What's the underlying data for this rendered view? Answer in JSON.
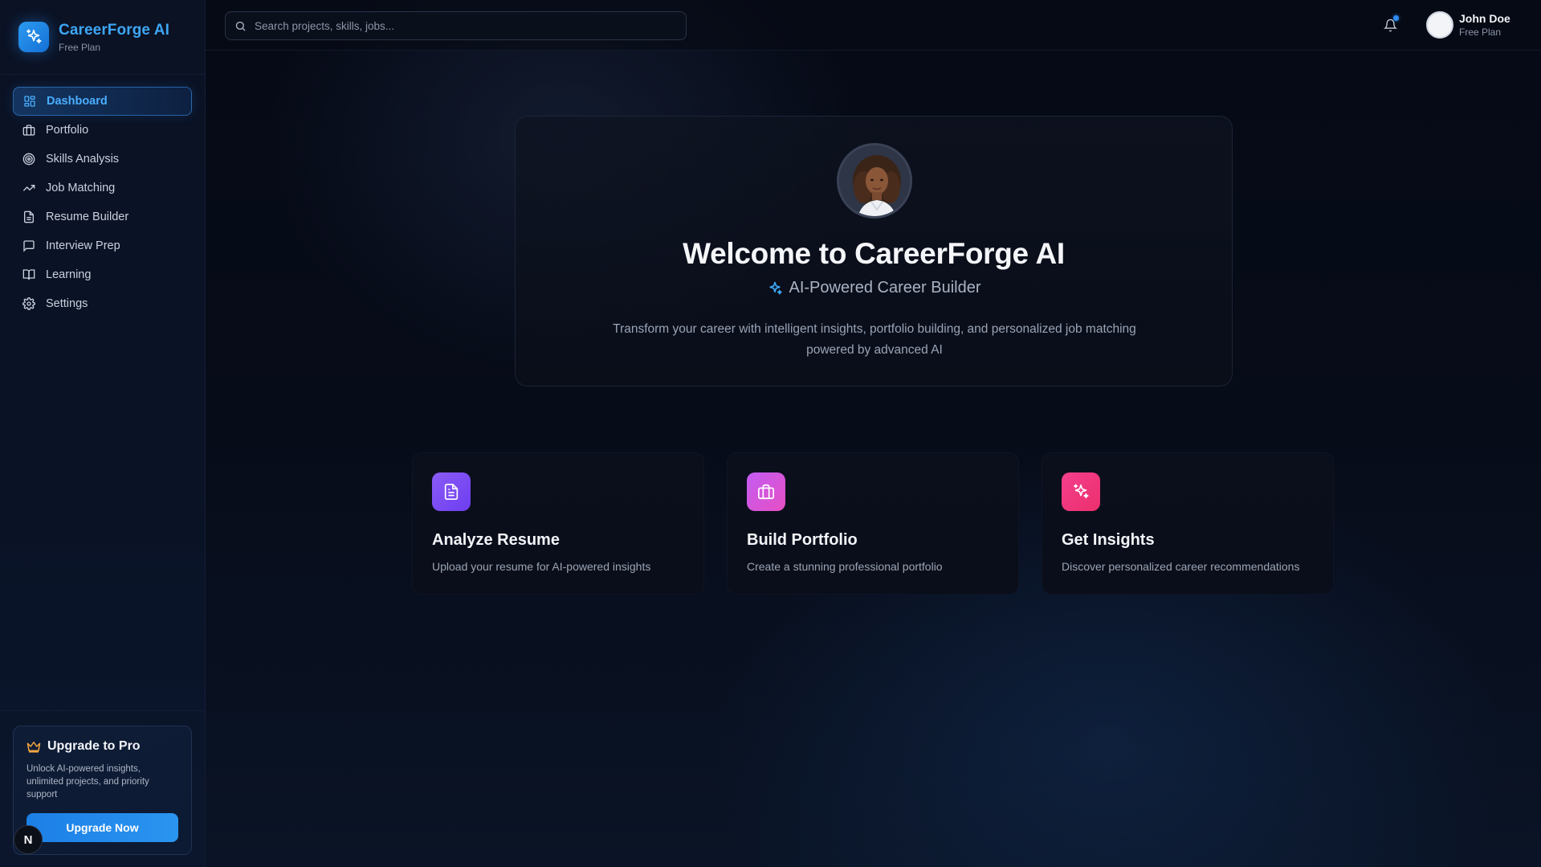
{
  "brand": {
    "name": "CareerForge AI",
    "plan": "Free Plan"
  },
  "sidebar": {
    "items": [
      {
        "label": "Dashboard",
        "icon": "layout-grid-icon",
        "active": true
      },
      {
        "label": "Portfolio",
        "icon": "briefcase-icon",
        "active": false
      },
      {
        "label": "Skills Analysis",
        "icon": "target-icon",
        "active": false
      },
      {
        "label": "Job Matching",
        "icon": "trending-up-icon",
        "active": false
      },
      {
        "label": "Resume Builder",
        "icon": "file-text-icon",
        "active": false
      },
      {
        "label": "Interview Prep",
        "icon": "message-square-icon",
        "active": false
      },
      {
        "label": "Learning",
        "icon": "book-open-icon",
        "active": false
      },
      {
        "label": "Settings",
        "icon": "gear-icon",
        "active": false
      }
    ],
    "upgrade": {
      "title": "Upgrade to Pro",
      "description": "Unlock AI-powered insights, unlimited projects, and priority support",
      "button": "Upgrade Now"
    },
    "badge": "N"
  },
  "header": {
    "search_placeholder": "Search projects, skills, jobs...",
    "user": {
      "name": "John Doe",
      "plan": "Free Plan"
    },
    "has_notification": true
  },
  "hero": {
    "title": "Welcome to CareerForge AI",
    "subtitle": "AI-Powered Career Builder",
    "description": "Transform your career with intelligent insights, portfolio building, and personalized job matching powered by advanced AI"
  },
  "cards": [
    {
      "title": "Analyze Resume",
      "description": "Upload your resume for AI-powered insights",
      "icon": "file-text-icon",
      "color_from": "#8b5cf6",
      "color_to": "#6d3df0"
    },
    {
      "title": "Build Portfolio",
      "description": "Create a stunning professional portfolio",
      "icon": "briefcase-icon",
      "color_from": "#c35cf2",
      "color_to": "#e64fc4"
    },
    {
      "title": "Get Insights",
      "description": "Discover personalized career recommendations",
      "icon": "sparkles-icon",
      "color_from": "#f43f8e",
      "color_to": "#ec2f6c"
    }
  ],
  "colors": {
    "accent": "#3ea6f5",
    "background": "#060a16"
  }
}
